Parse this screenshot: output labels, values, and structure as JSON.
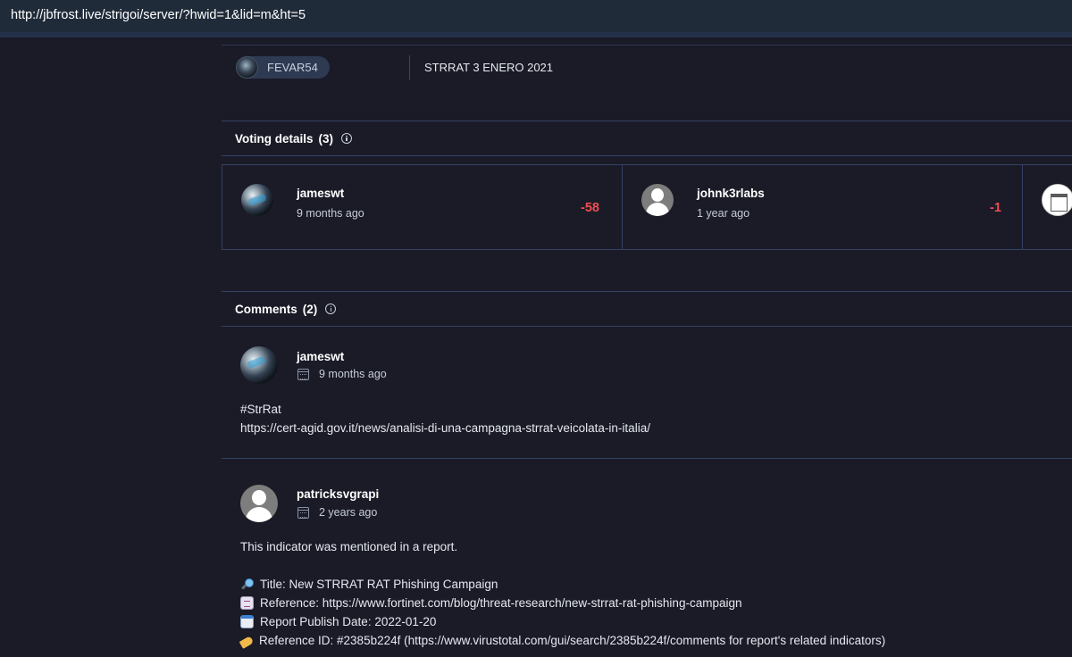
{
  "browser": {
    "url": "http://jbfrost.live/strigoi/server/?hwid=1&lid=m&ht=5"
  },
  "file_row": {
    "user": "FEVAR54",
    "filename": "STRRAT 3 ENERO 2021"
  },
  "voting": {
    "title": "Voting details",
    "count": "(3)",
    "votes": [
      {
        "user": "jameswt",
        "when": "9 months ago",
        "score": "-58",
        "avatar": "photo"
      },
      {
        "user": "johnk3rlabs",
        "when": "1 year ago",
        "score": "-1",
        "avatar": "default-user"
      },
      {
        "avatar": "building"
      }
    ]
  },
  "comments": {
    "title": "Comments",
    "count": "(2)",
    "items": [
      {
        "user": "jameswt",
        "date": "9 months ago",
        "lines": [
          "#StrRat",
          "https://cert-agid.gov.it/news/analisi-di-una-campagna-strrat-veicolata-in-italia/"
        ]
      },
      {
        "user": "patricksvgrapi",
        "date": "2 years ago",
        "intro": "This indicator was mentioned in a report.",
        "details": [
          {
            "icon": "magnifier-icon",
            "text": "Title: New STRRAT RAT Phishing Campaign"
          },
          {
            "icon": "receipt-icon",
            "text": "Reference: https://www.fortinet.com/blog/threat-research/new-strrat-rat-phishing-campaign"
          },
          {
            "icon": "calendar-emoji-icon",
            "text": "Report Publish Date: 2022-01-20"
          },
          {
            "icon": "label-tag-icon",
            "text": "Reference ID: #2385b224f (https://www.virustotal.com/gui/search/2385b224f/comments for report's related indicators)"
          }
        ]
      }
    ]
  }
}
